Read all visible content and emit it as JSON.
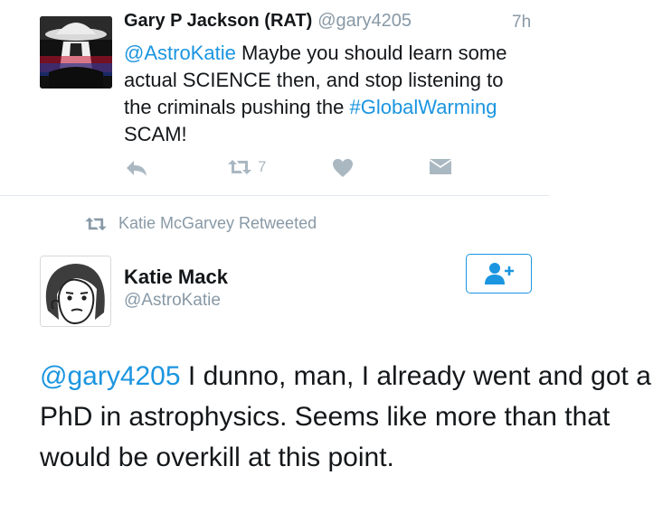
{
  "tweet1": {
    "author_name": "Gary P Jackson (RAT)",
    "author_handle": "@gary4205",
    "time": "7h",
    "text": {
      "mention": "@AstroKatie",
      "part1": " Maybe you should learn some actual SCIENCE then, and stop listening to the criminals pushing the ",
      "hashtag": "#GlobalWarming",
      "part2": " SCAM!"
    },
    "actions": {
      "reply_icon": "reply-icon",
      "retweet_icon": "retweet-icon",
      "retweet_count": "7",
      "like_icon": "heart-icon",
      "dm_icon": "direct-message-icon"
    }
  },
  "retweet_context": {
    "icon": "retweet-icon",
    "text": "Katie McGarvey Retweeted"
  },
  "tweet2": {
    "author_name": "Katie Mack",
    "author_handle": "@AstroKatie",
    "follow_icon": "follow-user-icon",
    "text": {
      "mention": "@gary4205",
      "body": " I dunno, man, I already went and got a PhD in astrophysics. Seems like more than that would be overkill at this point."
    }
  },
  "colors": {
    "link": "#1b95e0",
    "secondary_text": "#8899a6",
    "action_icon": "#aab8c2",
    "divider": "#e1e8ed"
  }
}
